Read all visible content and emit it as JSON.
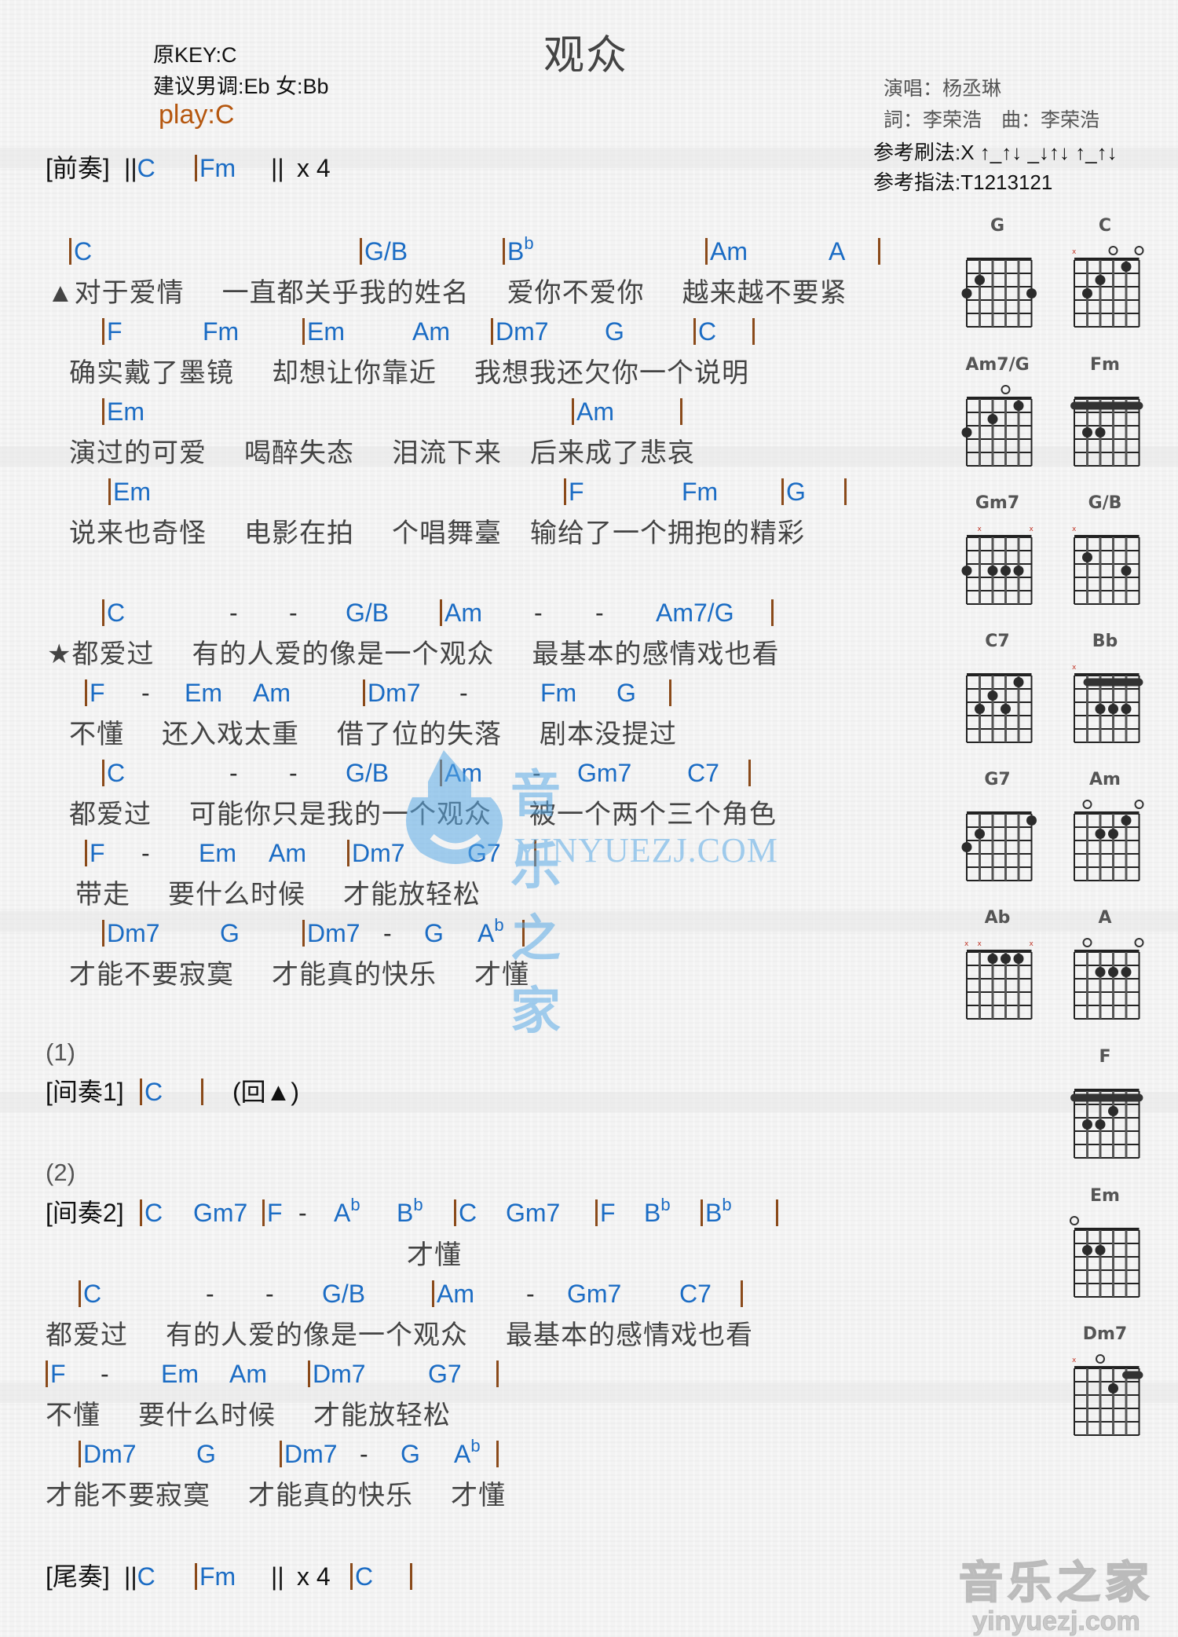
{
  "header": {
    "title": "观众",
    "original_key": "原KEY:C",
    "suggested_key": "建议男调:Eb 女:Bb",
    "play_key": "play:C",
    "singer": "演唱：杨丞琳",
    "credits": "詞：李荣浩　曲：李荣浩",
    "strum_pattern": "参考刷法:X ↑_↑↓ _↓↑↓ ↑_↑↓",
    "finger_pattern": "参考指法:T1213121"
  },
  "intro": {
    "label": "[前奏]",
    "tokens": [
      {
        "t": "||C"
      },
      {
        "t": "|Fm"
      },
      {
        "t": "||"
      },
      {
        "t": "x 4"
      }
    ]
  },
  "lines": [
    {
      "chords": [
        [
          "|",
          "C"
        ],
        [
          "|",
          "G/B"
        ],
        [
          "|",
          "B",
          "b"
        ],
        [
          "|",
          "Am"
        ],
        [
          "",
          "A"
        ],
        [
          "|",
          ""
        ]
      ],
      "lyric": [
        "▲对于爱情",
        "一直都关乎我的姓名",
        "爱你不爱你",
        "越来越不要紧"
      ]
    },
    {
      "chords": [
        [
          "|",
          "F"
        ],
        [
          "",
          "Fm"
        ],
        [
          "|",
          "Em"
        ],
        [
          "",
          "Am"
        ],
        [
          "|",
          "Dm7"
        ],
        [
          "",
          "G"
        ],
        [
          "|",
          "C"
        ],
        [
          "|",
          ""
        ]
      ],
      "lyric": [
        "确实戴了墨镜",
        "却想让你靠近",
        "我想我还欠你一个说明"
      ]
    },
    {
      "chords": [
        [
          "|",
          "Em"
        ],
        [
          "|",
          "Am"
        ],
        [
          "|",
          ""
        ]
      ],
      "lyric": [
        "演过的可爱",
        "喝醉失态",
        "泪流下来",
        "后来成了悲哀"
      ]
    },
    {
      "chords": [
        [
          "|",
          "Em"
        ],
        [
          "|",
          "F"
        ],
        [
          "",
          "Fm"
        ],
        [
          "|",
          "G"
        ],
        [
          "|",
          ""
        ]
      ],
      "lyric": [
        "说来也奇怪",
        "电影在拍",
        "个唱舞臺",
        "输给了一个拥抱的精彩"
      ]
    },
    {
      "chords": [
        [
          "|",
          "C"
        ],
        [
          "",
          "-"
        ],
        [
          "",
          "-"
        ],
        [
          "",
          "G/B"
        ],
        [
          "|",
          "Am"
        ],
        [
          "",
          "-"
        ],
        [
          "",
          "-"
        ],
        [
          "",
          "Am7/G"
        ],
        [
          "|",
          ""
        ]
      ],
      "lyric": [
        "★都爱过",
        "有的人爱的像是一个观众",
        "最基本的感情戏也看"
      ]
    },
    {
      "chords": [
        [
          "|",
          "F"
        ],
        [
          "",
          "-"
        ],
        [
          "",
          "Em"
        ],
        [
          "",
          "Am"
        ],
        [
          "|",
          "Dm7"
        ],
        [
          "",
          "-"
        ],
        [
          "",
          "Fm"
        ],
        [
          "",
          "G"
        ],
        [
          "|",
          ""
        ]
      ],
      "lyric": [
        "不懂",
        "还入戏太重",
        "借了位的失落",
        "剧本没提过"
      ]
    },
    {
      "chords": [
        [
          "|",
          "C"
        ],
        [
          "",
          "-"
        ],
        [
          "",
          "-"
        ],
        [
          "",
          "G/B"
        ],
        [
          "|",
          "Am"
        ],
        [
          "",
          "-"
        ],
        [
          "",
          "Gm7"
        ],
        [
          "",
          "C7"
        ],
        [
          "|",
          ""
        ]
      ],
      "lyric": [
        "都爱过",
        "可能你只是我的一个观众",
        "被一个两个三个角色"
      ]
    },
    {
      "chords": [
        [
          "|",
          "F"
        ],
        [
          "",
          "-"
        ],
        [
          "",
          "Em"
        ],
        [
          "",
          "Am"
        ],
        [
          "|",
          "Dm7"
        ],
        [
          "",
          "G7"
        ],
        [
          "|",
          ""
        ]
      ],
      "lyric": [
        "带走",
        "要什么时候",
        "才能放轻松"
      ]
    },
    {
      "chords": [
        [
          "|",
          "Dm7"
        ],
        [
          "",
          "G"
        ],
        [
          "|",
          "Dm7"
        ],
        [
          "",
          "-"
        ],
        [
          "",
          "G"
        ],
        [
          "",
          "A",
          "b"
        ],
        [
          "|",
          ""
        ]
      ],
      "lyric": [
        "才能不要寂寞",
        "才能真的快乐",
        "才懂"
      ]
    }
  ],
  "part1": {
    "number": "(1)",
    "label": "[间奏1]",
    "chord": "C",
    "note": "(回▲)"
  },
  "part2": {
    "number": "(2)",
    "label": "[间奏2]",
    "chords": [
      [
        "|",
        "C"
      ],
      [
        "",
        "Gm7"
      ],
      [
        "|",
        "F"
      ],
      [
        "",
        "-"
      ],
      [
        "",
        "A",
        "b"
      ],
      [
        "",
        "B",
        "b"
      ],
      [
        "|",
        "C"
      ],
      [
        "",
        "Gm7"
      ],
      [
        "|",
        "F"
      ],
      [
        "",
        "B",
        "b"
      ],
      [
        "|",
        "B",
        "b"
      ],
      [
        "|",
        ""
      ]
    ],
    "sub_lyric": "才懂",
    "lines": [
      {
        "chords": [
          [
            "|",
            "C"
          ],
          [
            "",
            "-"
          ],
          [
            "",
            "-"
          ],
          [
            "",
            "G/B"
          ],
          [
            "|",
            "Am"
          ],
          [
            "",
            "-"
          ],
          [
            "",
            "Gm7"
          ],
          [
            "",
            "C7"
          ],
          [
            "|",
            ""
          ]
        ],
        "lyric": [
          "都爱过",
          "有的人爱的像是一个观众",
          "最基本的感情戏也看"
        ]
      },
      {
        "chords": [
          [
            "|",
            "F"
          ],
          [
            "",
            "-"
          ],
          [
            "",
            "Em"
          ],
          [
            "",
            "Am"
          ],
          [
            "|",
            "Dm7"
          ],
          [
            "",
            "G7"
          ],
          [
            "|",
            ""
          ]
        ],
        "lyric": [
          "不懂",
          "要什么时候",
          "才能放轻松"
        ]
      },
      {
        "chords": [
          [
            "|",
            "Dm7"
          ],
          [
            "",
            "G"
          ],
          [
            "|",
            "Dm7"
          ],
          [
            "",
            "-"
          ],
          [
            "",
            "G"
          ],
          [
            "",
            "A",
            "b"
          ],
          [
            "|",
            ""
          ]
        ],
        "lyric": [
          "才能不要寂寞",
          "才能真的快乐",
          "才懂"
        ]
      }
    ]
  },
  "outro": {
    "label": "[尾奏]",
    "tokens": [
      {
        "t": "||C"
      },
      {
        "t": "|Fm"
      },
      {
        "t": "||"
      },
      {
        "t": "x 4"
      },
      {
        "t": "|C"
      },
      {
        "t": "|"
      }
    ]
  },
  "diagrams": [
    {
      "name": "G",
      "markers": [
        "",
        "",
        "",
        "",
        "",
        ""
      ],
      "barre": null,
      "dots": [
        [
          6,
          3
        ],
        [
          5,
          2
        ],
        [
          1,
          3
        ]
      ]
    },
    {
      "name": "C",
      "markers": [
        "x",
        "",
        "",
        "o",
        "",
        "o"
      ],
      "barre": null,
      "dots": [
        [
          5,
          3
        ],
        [
          4,
          2
        ],
        [
          2,
          1
        ]
      ]
    },
    {
      "name": "Am7/G",
      "markers": [
        "",
        "",
        "",
        "o",
        "",
        ""
      ],
      "barre": null,
      "dots": [
        [
          6,
          3
        ],
        [
          4,
          2
        ],
        [
          2,
          1
        ]
      ]
    },
    {
      "name": "Fm",
      "markers": [
        "",
        "",
        "",
        "",
        "",
        ""
      ],
      "barre": {
        "fret": 1,
        "from": 6,
        "to": 1
      },
      "dots": [
        [
          5,
          3
        ],
        [
          4,
          3
        ]
      ]
    },
    {
      "name": "Gm7",
      "markers": [
        "",
        "x",
        "",
        "",
        "",
        "x"
      ],
      "barre": null,
      "dots": [
        [
          6,
          3
        ],
        [
          4,
          3
        ],
        [
          3,
          3
        ],
        [
          2,
          3
        ]
      ]
    },
    {
      "name": "G/B",
      "markers": [
        "x",
        "",
        "",
        "",
        "",
        ""
      ],
      "barre": null,
      "dots": [
        [
          5,
          2
        ],
        [
          2,
          3
        ]
      ]
    },
    {
      "name": "C7",
      "markers": [
        "",
        "",
        "",
        "",
        "",
        ""
      ],
      "barre": null,
      "dots": [
        [
          5,
          3
        ],
        [
          4,
          2
        ],
        [
          3,
          3
        ],
        [
          2,
          1
        ]
      ]
    },
    {
      "name": "Bb",
      "markers": [
        "x",
        "",
        "",
        "",
        "",
        ""
      ],
      "barre": {
        "fret": 1,
        "from": 5,
        "to": 1
      },
      "dots": [
        [
          4,
          3
        ],
        [
          3,
          3
        ],
        [
          2,
          3
        ]
      ]
    },
    {
      "name": "G7",
      "markers": [
        "",
        "",
        "",
        "",
        "",
        ""
      ],
      "barre": null,
      "dots": [
        [
          6,
          3
        ],
        [
          5,
          2
        ],
        [
          1,
          1
        ]
      ]
    },
    {
      "name": "Am",
      "markers": [
        "",
        "o",
        "",
        "",
        "",
        "o"
      ],
      "barre": null,
      "dots": [
        [
          4,
          2
        ],
        [
          3,
          2
        ],
        [
          2,
          1
        ]
      ]
    },
    {
      "name": "Ab",
      "markers": [
        "x",
        "x",
        "",
        "",
        "",
        "x"
      ],
      "barre": null,
      "dots": [
        [
          4,
          1
        ],
        [
          3,
          1
        ],
        [
          2,
          1
        ]
      ]
    },
    {
      "name": "A",
      "markers": [
        "",
        "o",
        "",
        "",
        "",
        "o"
      ],
      "barre": null,
      "dots": [
        [
          4,
          2
        ],
        [
          3,
          2
        ],
        [
          2,
          2
        ]
      ]
    },
    {
      "name": "F",
      "markers": [
        "",
        "",
        "",
        "",
        "",
        ""
      ],
      "barre": {
        "fret": 1,
        "from": 6,
        "to": 1
      },
      "dots": [
        [
          5,
          3
        ],
        [
          4,
          3
        ],
        [
          3,
          2
        ]
      ]
    },
    {
      "name": "Em",
      "markers": [
        "o",
        "",
        "",
        "",
        "",
        ""
      ],
      "barre": null,
      "dots": [
        [
          5,
          2
        ],
        [
          4,
          2
        ]
      ]
    },
    {
      "name": "Dm7",
      "markers": [
        "x",
        "",
        "o",
        "",
        "",
        ""
      ],
      "barre": {
        "fret": 1,
        "from": 2,
        "to": 1
      },
      "dots": [
        [
          3,
          2
        ]
      ]
    }
  ],
  "watermark": {
    "cn": "音乐之家",
    "en": "YINYUEZJ.COM"
  },
  "logo": {
    "cn": "音乐之家",
    "en": "yinyuezj.com"
  },
  "colors": {
    "chord": "#1b6cc4",
    "bar": "#8a4a1a",
    "play": "#b5570f",
    "lyric": "#444444"
  }
}
